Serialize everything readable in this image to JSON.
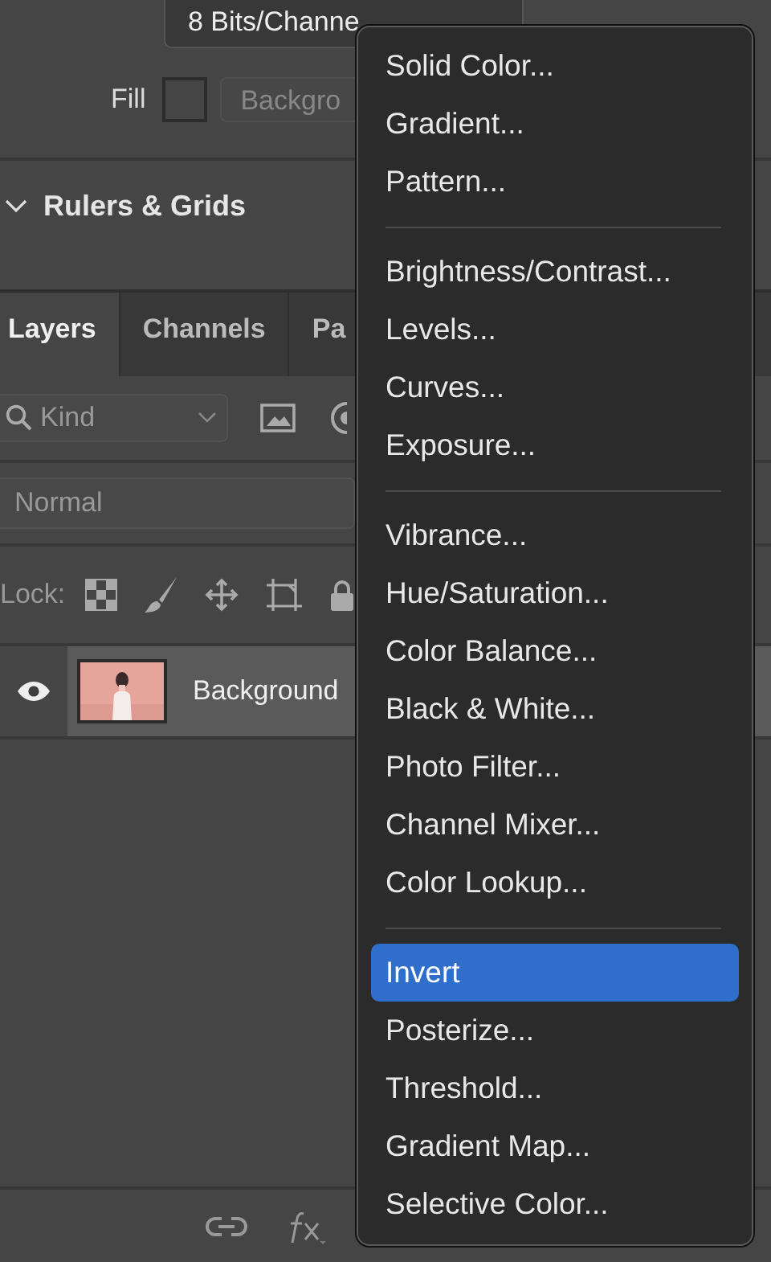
{
  "properties": {
    "bit_depth": "8 Bits/Channe",
    "fill_label": "Fill",
    "fill_value": "Backgro"
  },
  "section": {
    "title": "Rulers & Grids",
    "expanded": true
  },
  "tabs": [
    {
      "label": "Layers",
      "selected": true
    },
    {
      "label": "Channels",
      "selected": false
    },
    {
      "label": "Pa",
      "selected": false
    }
  ],
  "filter": {
    "value": "Kind"
  },
  "blend_mode": {
    "value": "Normal"
  },
  "lock_label": "Lock:",
  "layers": [
    {
      "name": "Background",
      "visible": true
    }
  ],
  "menu": [
    {
      "kind": "item",
      "label": "Solid Color...",
      "selected": false
    },
    {
      "kind": "item",
      "label": "Gradient...",
      "selected": false
    },
    {
      "kind": "item",
      "label": "Pattern...",
      "selected": false
    },
    {
      "kind": "separator"
    },
    {
      "kind": "item",
      "label": "Brightness/Contrast...",
      "selected": false
    },
    {
      "kind": "item",
      "label": "Levels...",
      "selected": false
    },
    {
      "kind": "item",
      "label": "Curves...",
      "selected": false
    },
    {
      "kind": "item",
      "label": "Exposure...",
      "selected": false
    },
    {
      "kind": "separator"
    },
    {
      "kind": "item",
      "label": "Vibrance...",
      "selected": false
    },
    {
      "kind": "item",
      "label": "Hue/Saturation...",
      "selected": false
    },
    {
      "kind": "item",
      "label": "Color Balance...",
      "selected": false
    },
    {
      "kind": "item",
      "label": "Black & White...",
      "selected": false
    },
    {
      "kind": "item",
      "label": "Photo Filter...",
      "selected": false
    },
    {
      "kind": "item",
      "label": "Channel Mixer...",
      "selected": false
    },
    {
      "kind": "item",
      "label": "Color Lookup...",
      "selected": false
    },
    {
      "kind": "separator"
    },
    {
      "kind": "item",
      "label": "Invert",
      "selected": true
    },
    {
      "kind": "item",
      "label": "Posterize...",
      "selected": false
    },
    {
      "kind": "item",
      "label": "Threshold...",
      "selected": false
    },
    {
      "kind": "item",
      "label": "Gradient Map...",
      "selected": false
    },
    {
      "kind": "item",
      "label": "Selective Color...",
      "selected": false
    }
  ]
}
